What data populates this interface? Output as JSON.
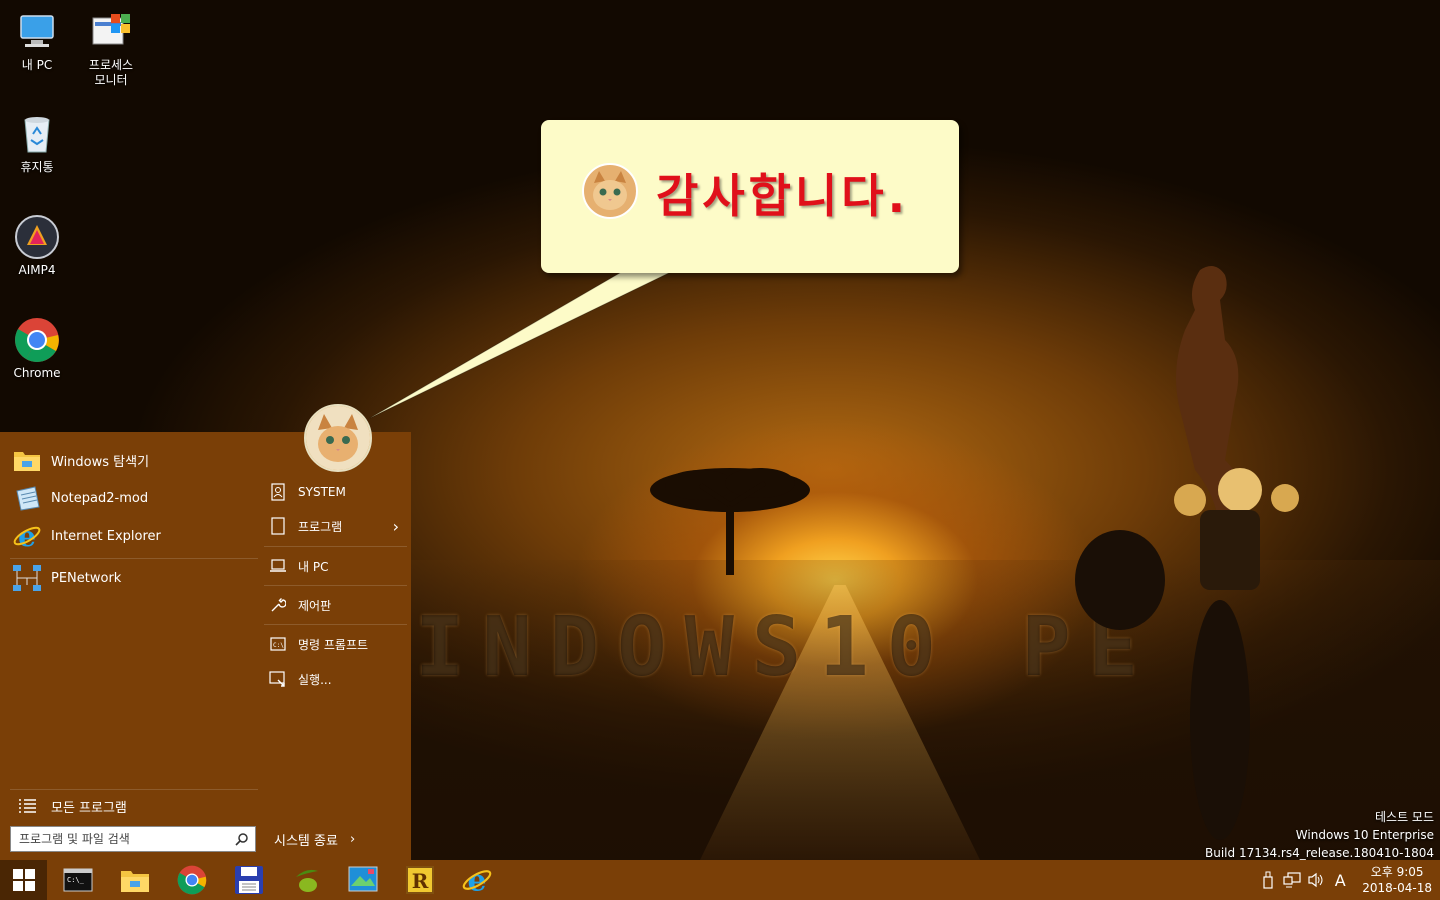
{
  "desktop": {
    "icons": [
      {
        "label": "내 PC",
        "icon": "computer-icon"
      },
      {
        "label": "프로세스\n모니터",
        "icon": "process-monitor-icon"
      },
      {
        "label": "휴지통",
        "icon": "recycle-bin-icon"
      },
      {
        "label": "AIMP4",
        "icon": "aimp-icon"
      },
      {
        "label": "Chrome",
        "icon": "chrome-icon"
      }
    ],
    "wallpaper_text": "INDOWS10 PE"
  },
  "callout": {
    "text": "감사합니다.",
    "bg_color": "#fdfbc8",
    "text_color": "#e0101a"
  },
  "start_menu": {
    "bg_color": "#7a3f07",
    "pinned": [
      {
        "label": "Windows 탐색기",
        "icon": "folder-icon"
      },
      {
        "label": "Notepad2-mod",
        "icon": "notepad-icon"
      },
      {
        "label": "Internet Explorer",
        "icon": "ie-icon"
      },
      {
        "label": "PENetwork",
        "icon": "network-icon"
      }
    ],
    "all_programs": "모든 프로그램",
    "search_placeholder": "프로그램 및 파일 검색",
    "right": [
      {
        "label": "SYSTEM",
        "icon": "user-icon"
      },
      {
        "label": "프로그램",
        "icon": "programs-icon",
        "submenu": true
      },
      {
        "label": "내 PC",
        "icon": "laptop-icon"
      },
      {
        "label": "제어판",
        "icon": "wrench-icon"
      },
      {
        "label": "명령 프롬프트",
        "icon": "cmd-icon"
      },
      {
        "label": "실행...",
        "icon": "run-icon"
      }
    ],
    "shutdown": "시스템 종료"
  },
  "taskbar": {
    "apps": [
      "cmd-icon",
      "explorer-icon",
      "chrome-icon",
      "save-icon",
      "olive-icon",
      "screenshot-icon",
      "r-icon",
      "ie-icon"
    ],
    "tray": {
      "ime": "A",
      "time": "오후 9:05",
      "date": "2018-04-18"
    }
  },
  "watermark": {
    "line1": "테스트 모드",
    "line2": "Windows 10 Enterprise",
    "line3": "Build 17134.rs4_release.180410-1804"
  }
}
